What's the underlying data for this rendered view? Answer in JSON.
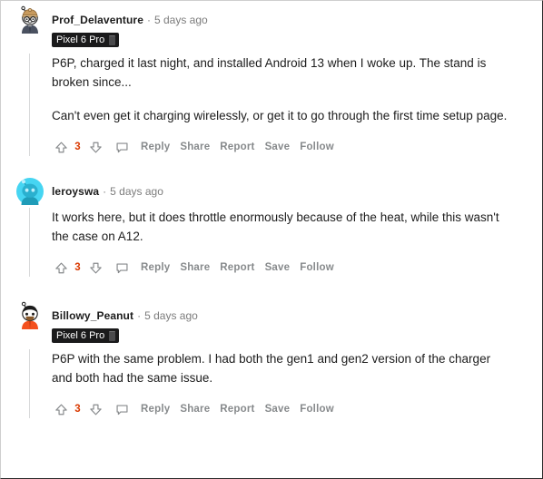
{
  "thread": {
    "comments": [
      {
        "username": "Prof_Delaventure",
        "separator": "·",
        "timestamp": "5 days ago",
        "flair": "Pixel 6 Pro",
        "has_flair": true,
        "avatar_style": "snoo-beanie-glasses-suit",
        "paragraphs": [
          "P6P, charged it last night, and installed Android 13 when I woke up. The stand is broken since...",
          "Can't even get it charging wirelessly, or get it to go through the first time setup page."
        ],
        "actions": {
          "upvote_icon": "arrow-up-icon",
          "score": "3",
          "downvote_icon": "arrow-down-icon",
          "comment_icon": "comment-bubble-icon",
          "links": [
            "Reply",
            "Share",
            "Report",
            "Save",
            "Follow"
          ]
        }
      },
      {
        "username": "leroyswa",
        "separator": "·",
        "timestamp": "5 days ago",
        "flair": "",
        "has_flair": false,
        "avatar_style": "snoo-cyan-circle",
        "paragraphs": [
          "It works here, but it does throttle enormously because of the heat, while this wasn't the case on A12."
        ],
        "actions": {
          "upvote_icon": "arrow-up-icon",
          "score": "3",
          "downvote_icon": "arrow-down-icon",
          "comment_icon": "comment-bubble-icon",
          "links": [
            "Reply",
            "Share",
            "Report",
            "Save",
            "Follow"
          ]
        }
      },
      {
        "username": "Billowy_Peanut",
        "separator": "·",
        "timestamp": "5 days ago",
        "flair": "Pixel 6 Pro",
        "has_flair": true,
        "avatar_style": "snoo-beard-orange-shirt",
        "paragraphs": [
          "P6P with the same problem. I had both the gen1 and gen2 version of the charger and both had the same issue."
        ],
        "actions": {
          "upvote_icon": "arrow-up-icon",
          "score": "3",
          "downvote_icon": "arrow-down-icon",
          "comment_icon": "comment-bubble-icon",
          "links": [
            "Reply",
            "Share",
            "Report",
            "Save",
            "Follow"
          ]
        }
      }
    ]
  },
  "colors": {
    "score_accent": "#d93900",
    "link_gray": "#878a8c",
    "text": "#1c1c1c",
    "meta_gray": "#7c7c7c",
    "flair_bg": "#1a1a1b",
    "threadline": "#d9dadb",
    "avatar_cyan": "#46d5f2"
  }
}
